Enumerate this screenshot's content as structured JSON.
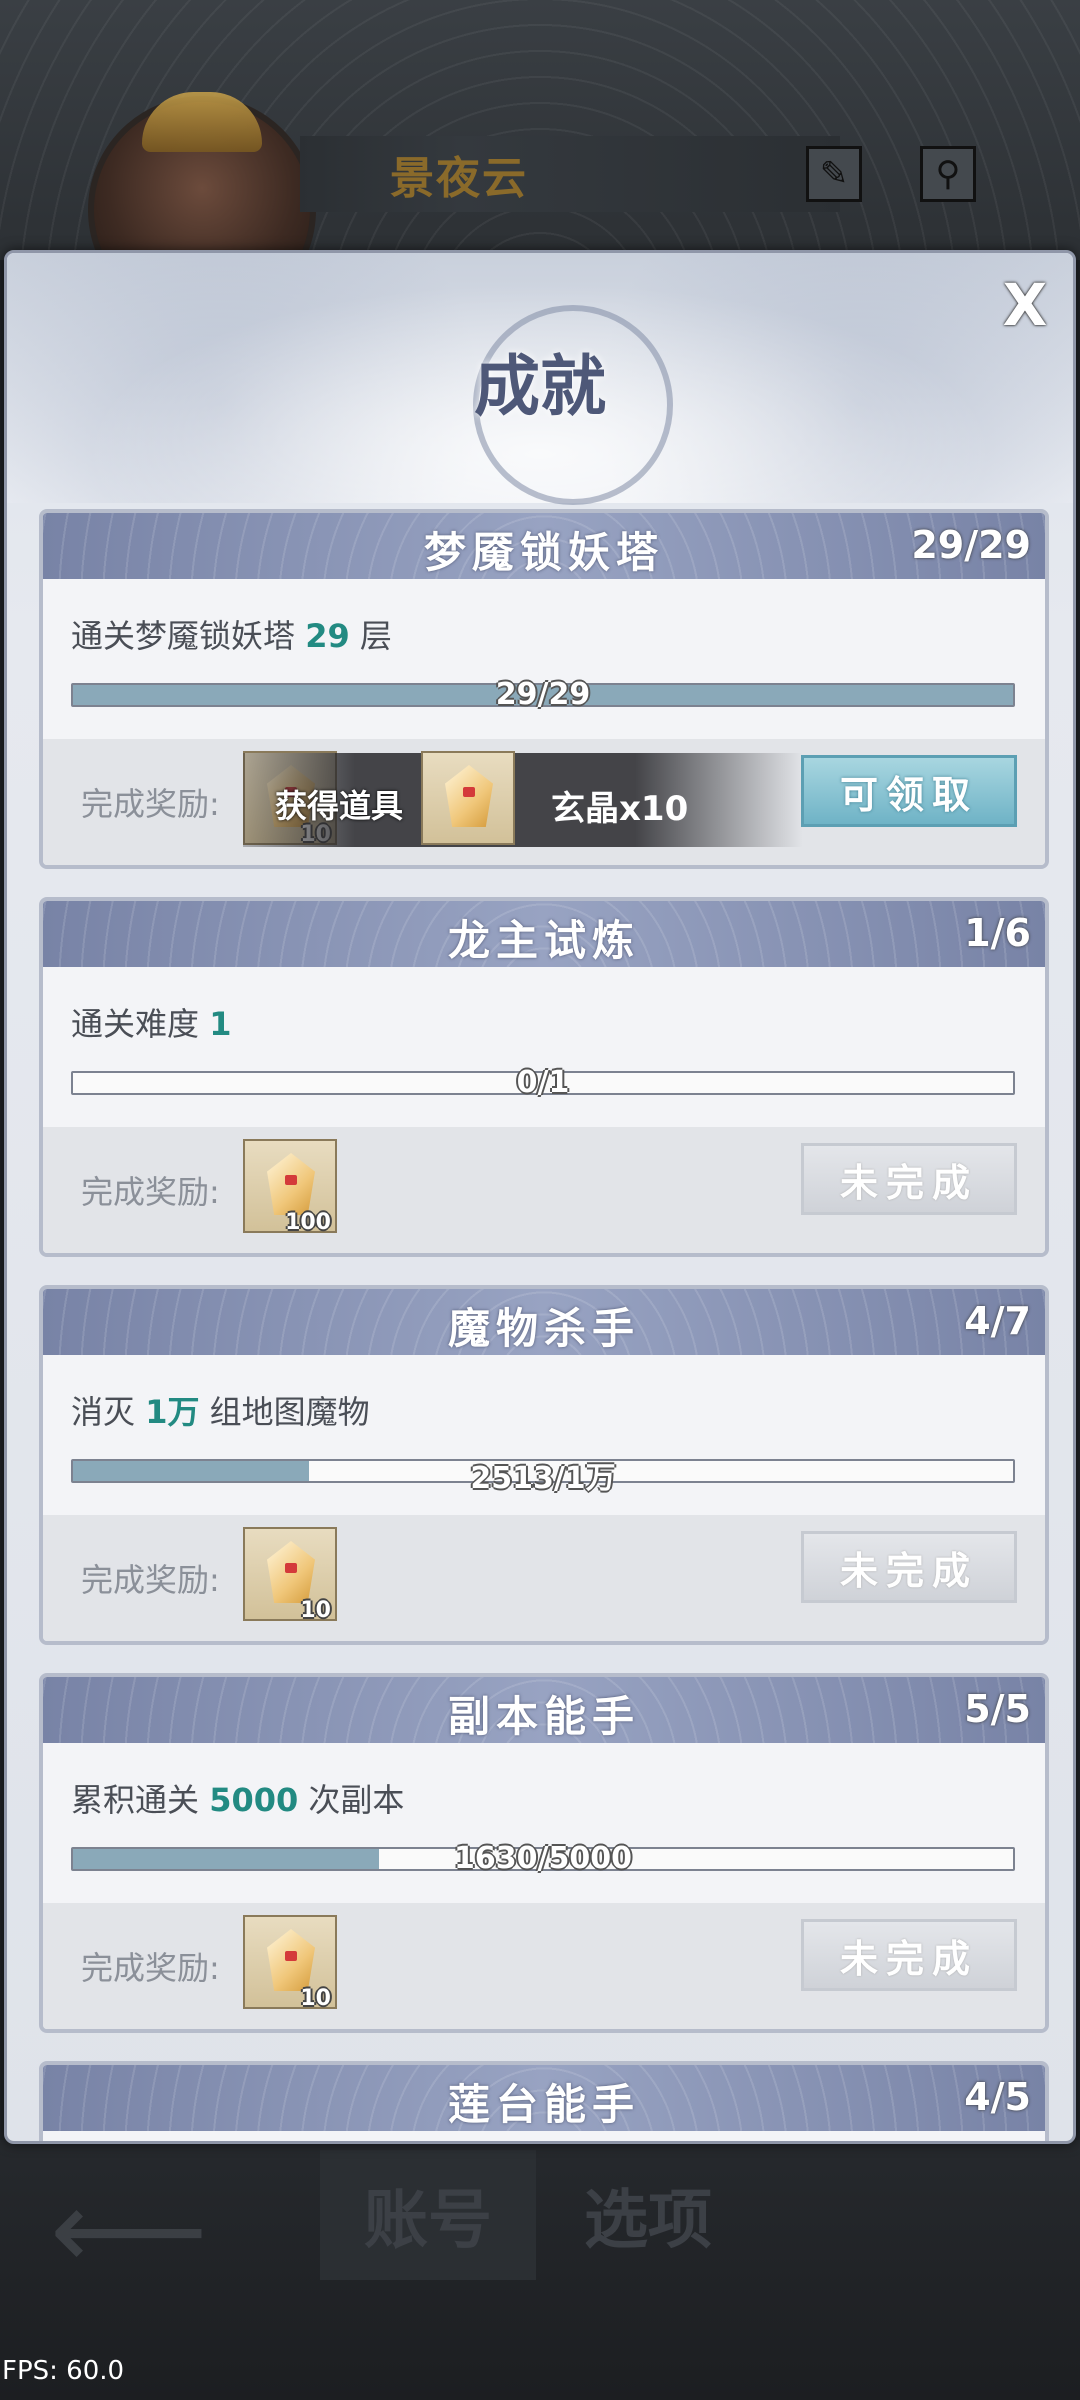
{
  "player": {
    "name": "景夜云"
  },
  "header_icons": [
    "brush-icon",
    "keyhole-icon"
  ],
  "panel": {
    "title": "成就",
    "close_label": "X"
  },
  "achievements": [
    {
      "title": "梦魇锁妖塔",
      "count": "29/29",
      "desc_prefix": "通关梦魇锁妖塔",
      "desc_value": "29",
      "desc_suffix": "层",
      "progress_text": "29/29",
      "progress_fraction": 1.0,
      "reward_label": "完成奖励:",
      "reward_qty": "10",
      "state_label": "可领取",
      "state": "claimable",
      "tooltip": {
        "label": "获得道具",
        "item_name": "玄晶x10"
      }
    },
    {
      "title": "龙主试炼",
      "count": "1/6",
      "desc_prefix": "通关难度",
      "desc_value": "1",
      "desc_suffix": "",
      "progress_text": "0/1",
      "progress_fraction": 0.0,
      "reward_label": "完成奖励:",
      "reward_qty": "100",
      "state_label": "未完成",
      "state": "incomplete"
    },
    {
      "title": "魔物杀手",
      "count": "4/7",
      "desc_prefix": "消灭",
      "desc_value": "1万",
      "desc_suffix": "组地图魔物",
      "progress_text": "2513/1万",
      "progress_fraction": 0.2513,
      "reward_label": "完成奖励:",
      "reward_qty": "10",
      "state_label": "未完成",
      "state": "incomplete"
    },
    {
      "title": "副本能手",
      "count": "5/5",
      "desc_prefix": "累积通关",
      "desc_value": "5000",
      "desc_suffix": "次副本",
      "progress_text": "1630/5000",
      "progress_fraction": 0.326,
      "reward_label": "完成奖励:",
      "reward_qty": "10",
      "state_label": "未完成",
      "state": "incomplete"
    },
    {
      "title": "莲台能手",
      "count": "4/5"
    }
  ],
  "bottom_nav": {
    "back_icon": "back-arrow-icon",
    "tab_account": "账号",
    "tab_options": "选项"
  },
  "fps": "FPS: 60.0"
}
